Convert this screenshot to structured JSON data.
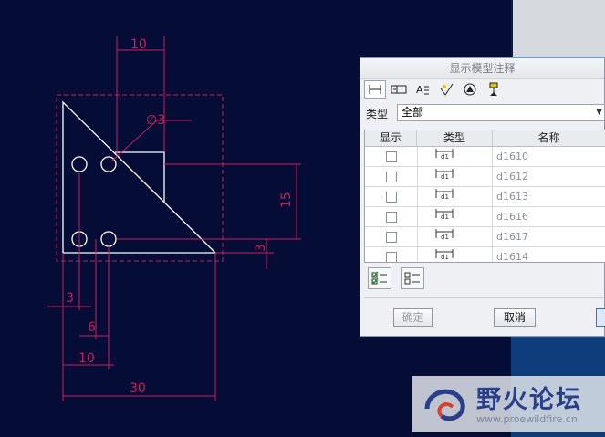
{
  "drawing": {
    "dims": {
      "top": "10",
      "hole": "∅3",
      "vertical": "15",
      "small_vertical": "3",
      "h3": "3",
      "h6": "6",
      "h10": "10",
      "h30": "30"
    }
  },
  "dialog": {
    "title": "显示模型注释",
    "type_label": "类型",
    "type_value": "全部",
    "columns": [
      "显示",
      "类型",
      "名称"
    ],
    "rows": [
      {
        "name": "d1610"
      },
      {
        "name": "d1612"
      },
      {
        "name": "d1613"
      },
      {
        "name": "d1616"
      },
      {
        "name": "d1617"
      },
      {
        "name": "d1614"
      }
    ],
    "ok_label": "确定",
    "cancel_label": "取消"
  },
  "watermark": {
    "title": "野火论坛",
    "url": "www.proewildfire.cn"
  },
  "colors": {
    "canvas": "#050d36",
    "dimension": "#c8205a",
    "geometry": "#ffffff"
  }
}
